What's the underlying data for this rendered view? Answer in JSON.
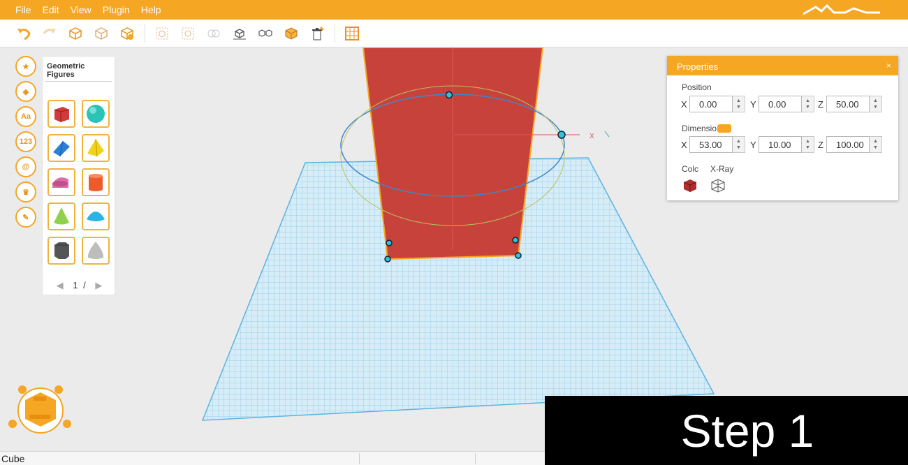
{
  "menu": [
    "File",
    "Edit",
    "View",
    "Plugin",
    "Help"
  ],
  "toolbar": {
    "buttons": [
      "undo-icon",
      "redo-icon",
      "new-shape-icon",
      "open-shape-icon",
      "import-shape-icon",
      "group-icon",
      "ungroup-icon",
      "duplicate-icon",
      "align-icon",
      "pattern-icon",
      "box-icon",
      "delete-icon",
      "grid-icon"
    ]
  },
  "sidebar": {
    "icons": [
      {
        "name": "favorites-icon",
        "glyph": "★"
      },
      {
        "name": "geometric-figures-icon",
        "glyph": "◆"
      },
      {
        "name": "text-icon",
        "glyph": "Aa"
      },
      {
        "name": "numbers-icon",
        "glyph": "123"
      },
      {
        "name": "symbols-icon",
        "glyph": "@"
      },
      {
        "name": "crown-icon",
        "glyph": "♛"
      },
      {
        "name": "tools-icon",
        "glyph": "✎"
      }
    ]
  },
  "shape_panel": {
    "title": "Geometric Figures",
    "shapes": [
      "cube",
      "sphere",
      "wedge",
      "pyramid",
      "half-cylinder",
      "cylinder",
      "cone",
      "hemisphere",
      "hexagonal-prism",
      "paraboloid"
    ],
    "page": "1",
    "page_sep": "/"
  },
  "properties": {
    "title": "Properties",
    "close": "×",
    "position_label": "Position",
    "position": {
      "x": "0.00",
      "y": "0.00",
      "z": "50.00"
    },
    "dimension_label": "Dimensio",
    "dimension": {
      "x": "53.00",
      "y": "10.00",
      "z": "100.00"
    },
    "color_label": "Colc",
    "xray_label": "X-Ray",
    "axis_x": "X",
    "axis_y": "Y",
    "axis_z": "Z"
  },
  "status": {
    "text": "Cube"
  },
  "overlay": {
    "text": "Step 1"
  },
  "colors": {
    "accent": "#f5a623",
    "shape": "#c8423c",
    "grid": "#8fc9e8"
  }
}
